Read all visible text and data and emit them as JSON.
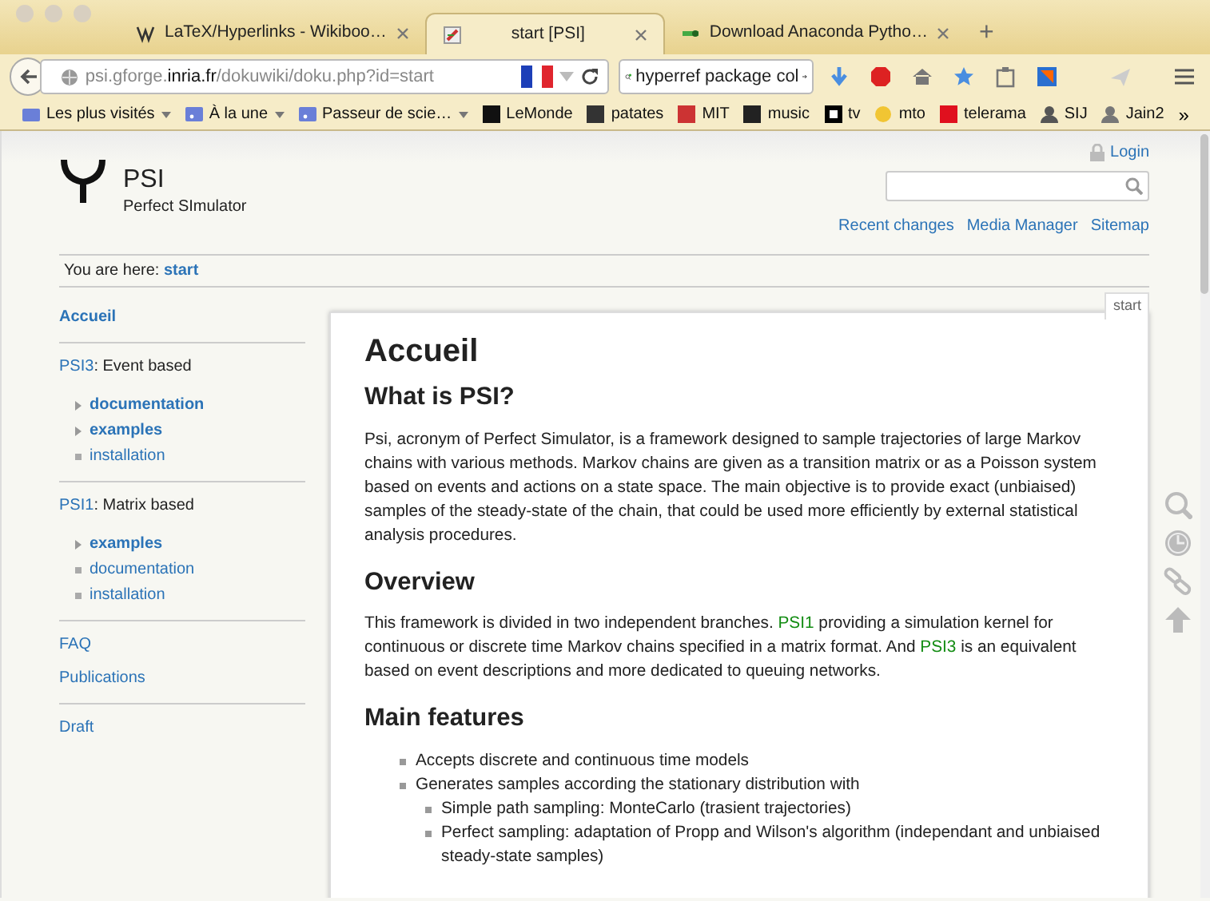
{
  "browser": {
    "tabs": [
      {
        "title": "LaTeX/Hyperlinks - Wikiboo…",
        "selected": false
      },
      {
        "title": "start [PSI]",
        "selected": true
      },
      {
        "title": "Download Anaconda Pytho…",
        "selected": false
      }
    ],
    "new_tab": "+",
    "url": "psi.gforge.**inria.fr**/dokuwiki/doku.php?id=start",
    "search_value": "hyperref package col",
    "bookmarks": [
      {
        "label": "Les plus visités",
        "has_menu": true
      },
      {
        "label": "À la une",
        "has_menu": true
      },
      {
        "label": "Passeur de scie…",
        "has_menu": true
      },
      {
        "label": "LeMonde",
        "has_menu": false
      },
      {
        "label": "patates",
        "has_menu": false
      },
      {
        "label": "MIT",
        "has_menu": false
      },
      {
        "label": "music",
        "has_menu": false
      },
      {
        "label": "tv",
        "has_menu": false
      },
      {
        "label": "mto",
        "has_menu": false
      },
      {
        "label": "telerama",
        "has_menu": false
      },
      {
        "label": "SIJ",
        "has_menu": false
      },
      {
        "label": "Jain2",
        "has_menu": false
      }
    ],
    "more_bookmarks": "»"
  },
  "site": {
    "title": "PSI",
    "tagline": "Perfect SImulator",
    "login": "Login",
    "links": [
      "Recent changes",
      "Media Manager",
      "Sitemap"
    ],
    "breadcrumb_label": "You are here:",
    "breadcrumb": "start"
  },
  "sidebar": [
    {
      "links": [
        {
          "label": "Accueil",
          "current": true
        }
      ]
    },
    {
      "heading": {
        "link": "PSI3",
        "text": ": Event based"
      },
      "items": [
        {
          "label": "documentation",
          "kind": "namespace"
        },
        {
          "label": "examples",
          "kind": "namespace"
        },
        {
          "label": "installation",
          "kind": "page"
        }
      ]
    },
    {
      "heading": {
        "link": "PSI1",
        "text": ": Matrix based"
      },
      "items": [
        {
          "label": "examples",
          "kind": "namespace"
        },
        {
          "label": "documentation",
          "kind": "page"
        },
        {
          "label": "installation",
          "kind": "page"
        }
      ]
    },
    {
      "links": [
        {
          "label": "FAQ",
          "current": false
        },
        {
          "label": "Publications",
          "current": false
        }
      ]
    },
    {
      "links": [
        {
          "label": "Draft",
          "current": false
        }
      ]
    }
  ],
  "page_tab": "start",
  "content": [
    {
      "kind": "h1",
      "text": "Accueil"
    },
    {
      "kind": "h2",
      "text": "What is PSI?"
    },
    {
      "kind": "p",
      "parts": [
        {
          "text": "Psi, acronym of Perfect Simulator, is a framework designed to sample trajectories of large Markov chains with various methods. Markov chains are given as a transition matrix or as a Poisson system based on events and actions on a state space. The main objective is to provide exact (unbiaised) samples of the steady-state of the chain, that could be used more efficiently by external statistical analysis procedures."
        }
      ]
    },
    {
      "kind": "h2",
      "text": "Overview"
    },
    {
      "kind": "p",
      "parts": [
        {
          "text": "This framework is divided in two independent branches. "
        },
        {
          "link": "PSI1"
        },
        {
          "text": " providing a simulation kernel for continuous or discrete time Markov chains specified in a matrix format. And "
        },
        {
          "link": "PSI3"
        },
        {
          "text": " is an equivalent based on event descriptions and more dedicated to queuing networks."
        }
      ]
    },
    {
      "kind": "h2",
      "text": "Main features"
    },
    {
      "kind": "ul",
      "items": [
        {
          "text": "Accepts discrete and continuous time models"
        },
        {
          "text": "Generates samples according the stationary distribution with",
          "children": [
            {
              "text": "Simple path sampling: MonteCarlo (trasient trajectories)"
            },
            {
              "text": "Perfect sampling: adaptation of Propp and Wilson's algorithm (independant and unbiaised steady-state samples)"
            }
          ]
        }
      ]
    }
  ]
}
